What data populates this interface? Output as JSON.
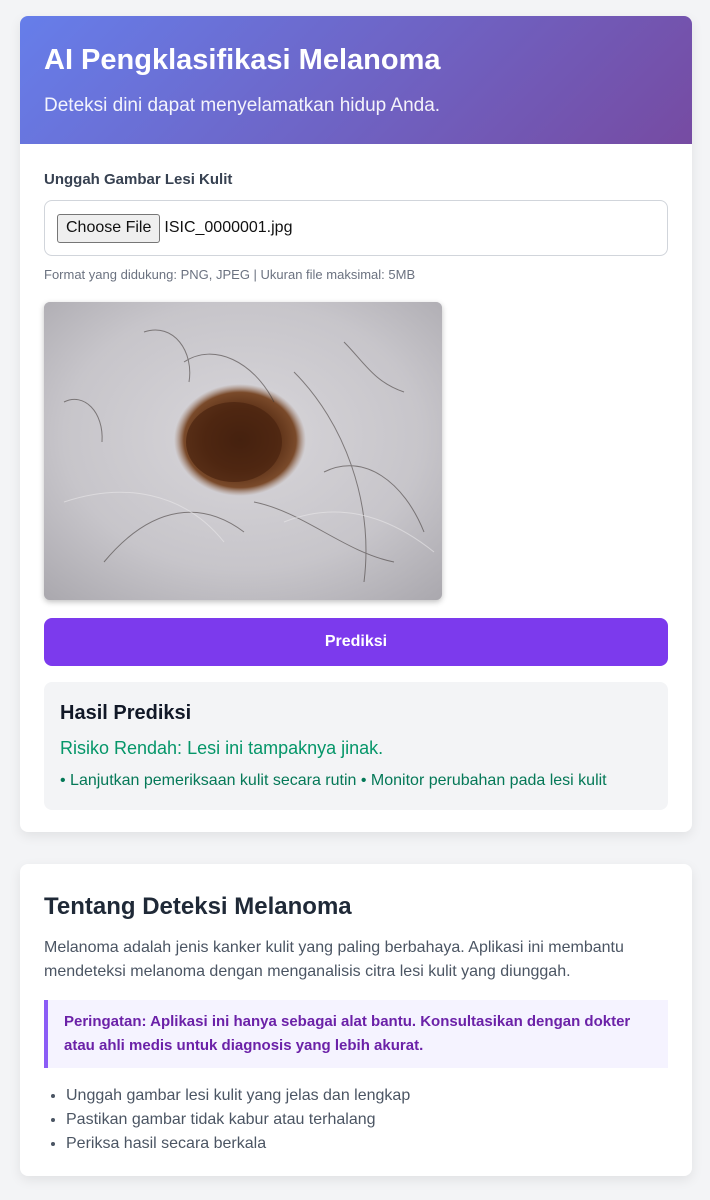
{
  "header": {
    "title": "AI Pengklasifikasi Melanoma",
    "subtitle": "Deteksi dini dapat menyelamatkan hidup Anda."
  },
  "upload": {
    "label": "Unggah Gambar Lesi Kulit",
    "button_label": "Choose File",
    "file_name": "ISIC_0000001.jpg",
    "hint": "Format yang didukung: PNG, JPEG | Ukuran file maksimal: 5MB"
  },
  "predict_button": "Prediksi",
  "result": {
    "title": "Hasil Prediksi",
    "risk": "Risiko Rendah: Lesi ini tampaknya jinak.",
    "advice": "• Lanjutkan pemeriksaan kulit secara rutin • Monitor perubahan pada lesi kulit"
  },
  "info": {
    "title": "Tentang Deteksi Melanoma",
    "description": "Melanoma adalah jenis kanker kulit yang paling berbahaya. Aplikasi ini membantu mendeteksi melanoma dengan menganalisis citra lesi kulit yang diunggah.",
    "warning": "Peringatan: Aplikasi ini hanya sebagai alat bantu. Konsultasikan dengan dokter atau ahli medis untuk diagnosis yang lebih akurat.",
    "tips": [
      "Unggah gambar lesi kulit yang jelas dan lengkap",
      "Pastikan gambar tidak kabur atau terhalang",
      "Periksa hasil secara berkala"
    ]
  },
  "colors": {
    "header_gradient_start": "#667eea",
    "header_gradient_end": "#764ba2",
    "primary_button": "#7c3aed",
    "risk_low": "#059669",
    "warning_border": "#8b5cf6",
    "warning_text": "#6b21a8"
  }
}
